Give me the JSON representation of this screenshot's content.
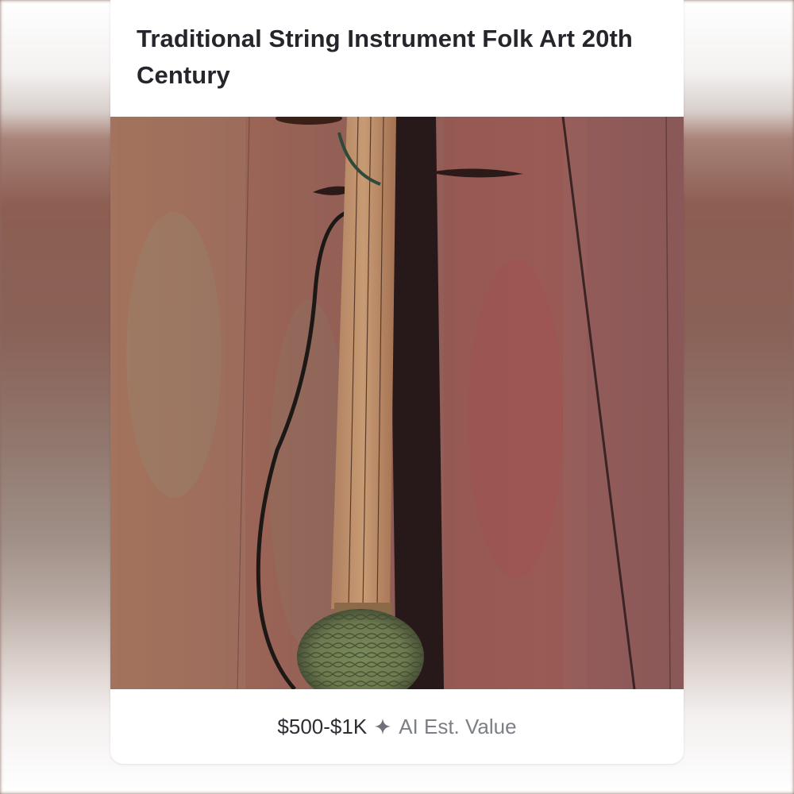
{
  "listing": {
    "title": "Traditional String Instrument Folk Art 20th Century",
    "price_range": "$500-$1K",
    "estimate_label": "AI Est. Value",
    "estimate_icon": "sparkle-icon"
  },
  "colors": {
    "title_text": "#24262b",
    "price_text": "#2c2e33",
    "estimate_text": "#7c7f86",
    "card_background": "#ffffff"
  }
}
